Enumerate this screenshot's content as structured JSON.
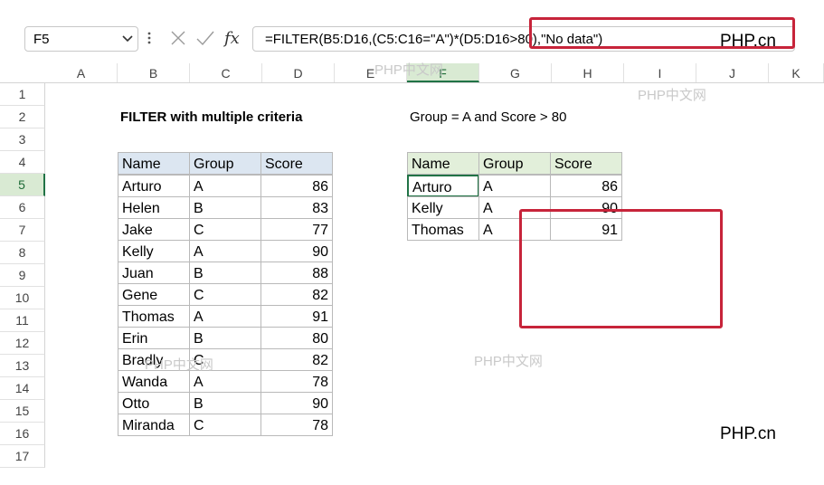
{
  "formula_bar": {
    "name_box": "F5",
    "formula": "=FILTER(B5:D16,(C5:C16=\"A\")*(D5:D16>80),\"No data\")"
  },
  "columns": [
    "A",
    "B",
    "C",
    "D",
    "E",
    "F",
    "G",
    "H",
    "I",
    "J",
    "K"
  ],
  "rows": [
    "1",
    "2",
    "3",
    "4",
    "5",
    "6",
    "7",
    "8",
    "9",
    "10",
    "11",
    "12",
    "13",
    "14",
    "15",
    "16",
    "17"
  ],
  "title_left": "FILTER with multiple criteria",
  "title_right": "Group = A and Score > 80",
  "source_table": {
    "headers": [
      "Name",
      "Group",
      "Score"
    ],
    "rows": [
      [
        "Arturo",
        "A",
        "86"
      ],
      [
        "Helen",
        "B",
        "83"
      ],
      [
        "Jake",
        "C",
        "77"
      ],
      [
        "Kelly",
        "A",
        "90"
      ],
      [
        "Juan",
        "B",
        "88"
      ],
      [
        "Gene",
        "C",
        "82"
      ],
      [
        "Thomas",
        "A",
        "91"
      ],
      [
        "Erin",
        "B",
        "80"
      ],
      [
        "Bradly",
        "C",
        "82"
      ],
      [
        "Wanda",
        "A",
        "78"
      ],
      [
        "Otto",
        "B",
        "90"
      ],
      [
        "Miranda",
        "C",
        "78"
      ]
    ]
  },
  "result_table": {
    "headers": [
      "Name",
      "Group",
      "Score"
    ],
    "rows": [
      [
        "Arturo",
        "A",
        "86"
      ],
      [
        "Kelly",
        "A",
        "90"
      ],
      [
        "Thomas",
        "A",
        "91"
      ]
    ]
  },
  "watermarks": {
    "site_text": "PHP.cn",
    "cn_text": "PHP中文网"
  },
  "colors": {
    "selected_header": "#d9ead3",
    "accent_green": "#217346",
    "table_header_blue": "#dce6f1",
    "table_header_green": "#e2efda",
    "annotation_red": "#c7243a"
  }
}
